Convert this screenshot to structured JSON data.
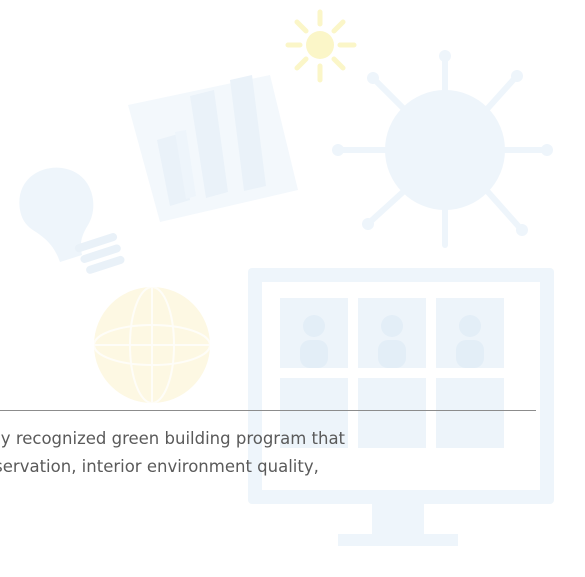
{
  "content": {
    "lines": [
      "This is an internationally recognized green building program that",
      "focuses on energy conservation, interior environment quality,"
    ]
  },
  "illustration": {
    "icons": [
      "sun-icon",
      "bar-chart-icon",
      "virus-icon",
      "lightbulb-icon",
      "globe-icon",
      "video-call-monitor-icon"
    ],
    "colors": {
      "pale_blue": "#eef5fb",
      "pale_yellow": "#fdf8e3",
      "sun_yellow": "#fbf6c8",
      "divider": "#8c8c8c",
      "text": "#5a5a5a"
    }
  }
}
